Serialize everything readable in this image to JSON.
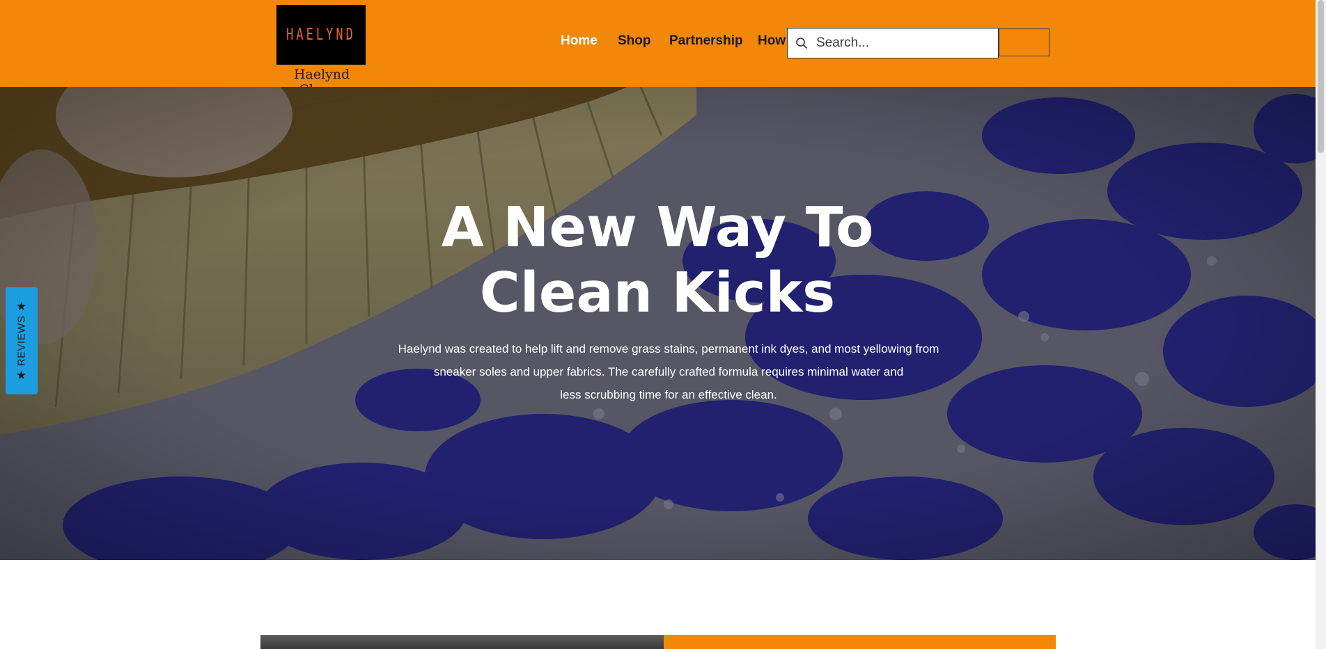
{
  "brand": {
    "logo_text": "HAELYND",
    "caption": "Haelynd Cleans"
  },
  "nav": {
    "items": [
      {
        "label": "Home",
        "active": true
      },
      {
        "label": "Shop",
        "active": false
      },
      {
        "label": "Partnership",
        "active": false
      },
      {
        "label": "How",
        "active": false
      }
    ]
  },
  "search": {
    "placeholder": "Search...",
    "icon": "search-icon"
  },
  "hero": {
    "title_line1": "A New Way To",
    "title_line2": "Clean Kicks",
    "body_line1": "Haelynd was created to help lift and remove grass stains, permanent ink dyes, and most yellowing from",
    "body_line2": "sneaker soles and upper fabrics. The carefully crafted formula requires minimal water and",
    "body_line3": "less scrubbing time for an effective clean."
  },
  "reviews_tab": {
    "label": "REVIEWS",
    "icon": "star-icon"
  },
  "colors": {
    "header_bg": "#f2870a",
    "reviews_tab_bg": "#1a9ee0",
    "hero_text": "#ffffff"
  }
}
